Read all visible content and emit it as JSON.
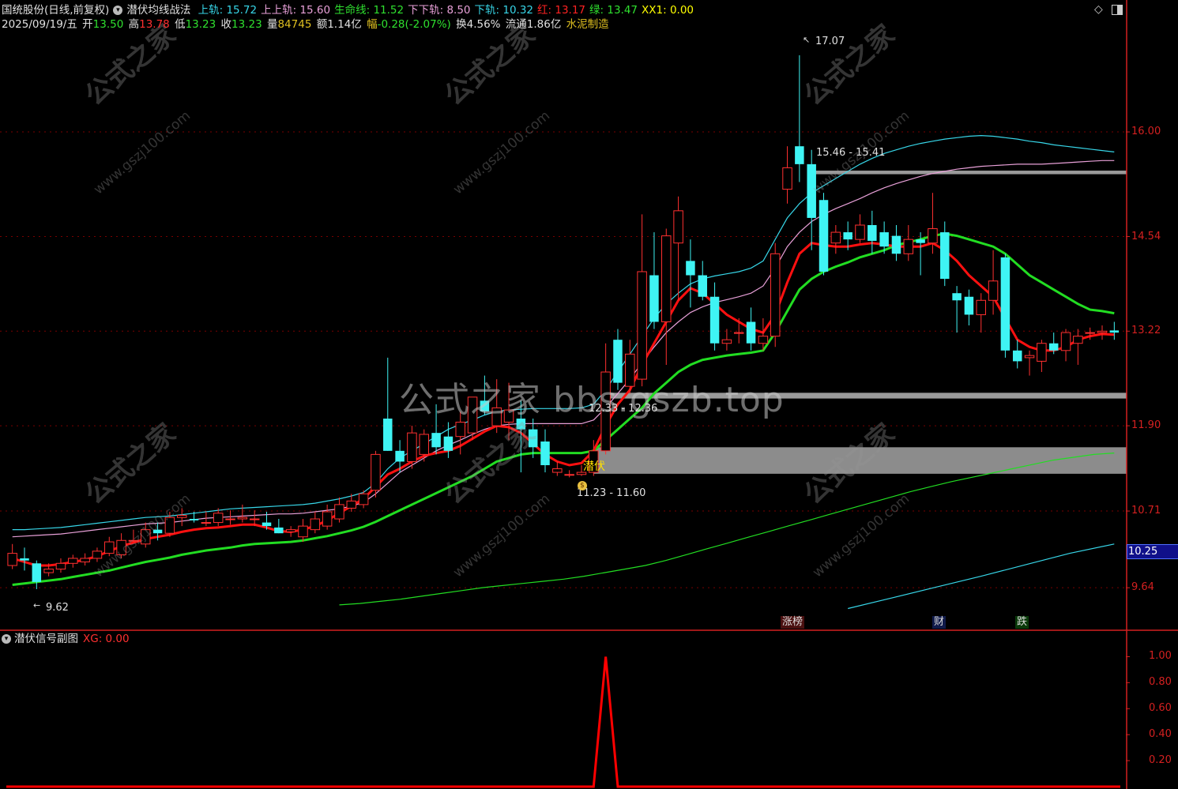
{
  "header": {
    "stock_label": "国统股份(日线,前复权)",
    "indicator_label": "潜伏均线战法",
    "fields": [
      {
        "label": "上轨",
        "value": "15.72",
        "color": "#37d6e8"
      },
      {
        "label": "上上轨",
        "value": "15.60",
        "color": "#e8a0d8"
      },
      {
        "label": "生命线",
        "value": "11.52",
        "color": "#2fe02f"
      },
      {
        "label": "下下轨",
        "value": "8.50",
        "color": "#e8a0d8"
      },
      {
        "label": "下轨",
        "value": "10.32",
        "color": "#37d6e8"
      },
      {
        "label": "红",
        "value": "13.17",
        "color": "#ff2222"
      },
      {
        "label": "绿",
        "value": "13.47",
        "color": "#2fe02f"
      },
      {
        "label": "XX1",
        "value": "0.00",
        "color": "#ffff00"
      }
    ]
  },
  "quote": {
    "date": "2025/09/19/五",
    "open_label": "开",
    "open": "13.50",
    "high_label": "高",
    "high": "13.78",
    "low_label": "低",
    "low": "13.23",
    "close_label": "收",
    "close": "13.23",
    "vol_label": "量",
    "vol": "84745",
    "amt_label": "额",
    "amt": "1.14亿",
    "chg_label": "幅",
    "chg": "-0.28(-2.07%)",
    "turn_label": "换",
    "turn": "4.56%",
    "float_label": "流通",
    "float": "1.86亿",
    "industry": "水泥制造"
  },
  "colors": {
    "up": "#ff3030",
    "down": "#3ff4f4",
    "grid": "#7a0000",
    "axis": "#d42020",
    "red_line": "#ff1010",
    "green_line": "#22dd22"
  },
  "annotations": {
    "high_label": "17.07",
    "low_label": "9.62",
    "zone_top": "15.46 - 15.41",
    "zone_mid": "12.33 - 12.36",
    "zone_low": "11.23 - 11.60",
    "signal": "潜伏",
    "current_price": "10.25"
  },
  "events": [
    {
      "label": "涨榜",
      "color": "#ff9090"
    },
    {
      "label": "财",
      "color": "#9fc8ff"
    },
    {
      "label": "跌",
      "color": "#40ff40"
    }
  ],
  "watermark": {
    "center": "公式之家 bbs.gszb.top",
    "stamp": "公式之家",
    "stamp_url": "www.gszj100.com"
  },
  "sub_panel": {
    "title": "潜伏信号副图",
    "xg_label": "XG: 0.00"
  },
  "chart_data": [
    {
      "type": "candlestick",
      "y_ticks": [
        "16.00",
        "14.54",
        "13.22",
        "11.90",
        "10.71",
        "9.64"
      ],
      "ylim": [
        9.3,
        17.4
      ],
      "grid": true,
      "candles": [
        {
          "o": 9.95,
          "h": 10.25,
          "l": 9.9,
          "c": 10.12
        },
        {
          "o": 10.05,
          "h": 10.2,
          "l": 9.88,
          "c": 10.02
        },
        {
          "o": 9.98,
          "h": 10.02,
          "l": 9.62,
          "c": 9.72
        },
        {
          "o": 9.85,
          "h": 9.98,
          "l": 9.8,
          "c": 9.9
        },
        {
          "o": 9.9,
          "h": 10.05,
          "l": 9.85,
          "c": 9.98
        },
        {
          "o": 9.98,
          "h": 10.1,
          "l": 9.92,
          "c": 10.05
        },
        {
          "o": 10.0,
          "h": 10.12,
          "l": 9.95,
          "c": 10.05
        },
        {
          "o": 10.05,
          "h": 10.2,
          "l": 10.0,
          "c": 10.15
        },
        {
          "o": 10.12,
          "h": 10.35,
          "l": 10.08,
          "c": 10.28
        },
        {
          "o": 10.1,
          "h": 10.4,
          "l": 10.05,
          "c": 10.3
        },
        {
          "o": 10.3,
          "h": 10.45,
          "l": 10.28,
          "c": 10.3
        },
        {
          "o": 10.25,
          "h": 10.55,
          "l": 10.2,
          "c": 10.45
        },
        {
          "o": 10.45,
          "h": 10.55,
          "l": 10.3,
          "c": 10.4
        },
        {
          "o": 10.4,
          "h": 10.7,
          "l": 10.35,
          "c": 10.62
        },
        {
          "o": 10.62,
          "h": 10.75,
          "l": 10.5,
          "c": 10.65
        },
        {
          "o": 10.6,
          "h": 10.7,
          "l": 10.55,
          "c": 10.58
        },
        {
          "o": 10.55,
          "h": 10.7,
          "l": 10.5,
          "c": 10.55
        },
        {
          "o": 10.55,
          "h": 10.75,
          "l": 10.5,
          "c": 10.68
        },
        {
          "o": 10.6,
          "h": 10.72,
          "l": 10.52,
          "c": 10.6
        },
        {
          "o": 10.6,
          "h": 10.8,
          "l": 10.55,
          "c": 10.62
        },
        {
          "o": 10.6,
          "h": 10.72,
          "l": 10.5,
          "c": 10.6
        },
        {
          "o": 10.55,
          "h": 10.7,
          "l": 10.45,
          "c": 10.5
        },
        {
          "o": 10.48,
          "h": 10.6,
          "l": 10.4,
          "c": 10.4
        },
        {
          "o": 10.42,
          "h": 10.5,
          "l": 10.35,
          "c": 10.45
        },
        {
          "o": 10.35,
          "h": 10.6,
          "l": 10.28,
          "c": 10.5
        },
        {
          "o": 10.45,
          "h": 10.7,
          "l": 10.4,
          "c": 10.6
        },
        {
          "o": 10.5,
          "h": 10.8,
          "l": 10.45,
          "c": 10.7
        },
        {
          "o": 10.6,
          "h": 10.9,
          "l": 10.55,
          "c": 10.8
        },
        {
          "o": 10.75,
          "h": 10.95,
          "l": 10.7,
          "c": 10.85
        },
        {
          "o": 10.8,
          "h": 11.0,
          "l": 10.75,
          "c": 10.95
        },
        {
          "o": 11.0,
          "h": 11.55,
          "l": 10.9,
          "c": 11.5
        },
        {
          "o": 12.0,
          "h": 12.85,
          "l": 11.55,
          "c": 11.55
        },
        {
          "o": 11.55,
          "h": 11.7,
          "l": 11.25,
          "c": 11.4
        },
        {
          "o": 11.4,
          "h": 11.9,
          "l": 11.3,
          "c": 11.8
        },
        {
          "o": 11.5,
          "h": 11.85,
          "l": 11.4,
          "c": 11.78
        },
        {
          "o": 11.8,
          "h": 12.2,
          "l": 11.5,
          "c": 11.6
        },
        {
          "o": 11.75,
          "h": 11.95,
          "l": 11.45,
          "c": 11.55
        },
        {
          "o": 11.75,
          "h": 12.1,
          "l": 11.5,
          "c": 11.95
        },
        {
          "o": 11.8,
          "h": 12.3,
          "l": 11.7,
          "c": 12.3
        },
        {
          "o": 12.25,
          "h": 12.6,
          "l": 12.05,
          "c": 12.1
        },
        {
          "o": 11.9,
          "h": 12.55,
          "l": 11.8,
          "c": 12.15
        },
        {
          "o": 11.95,
          "h": 12.5,
          "l": 11.7,
          "c": 12.12
        },
        {
          "o": 12.0,
          "h": 12.25,
          "l": 11.25,
          "c": 11.85
        },
        {
          "o": 11.85,
          "h": 12.0,
          "l": 11.45,
          "c": 11.6
        },
        {
          "o": 11.68,
          "h": 11.85,
          "l": 11.25,
          "c": 11.35
        },
        {
          "o": 11.25,
          "h": 11.4,
          "l": 11.2,
          "c": 11.3
        },
        {
          "o": 11.22,
          "h": 11.28,
          "l": 11.18,
          "c": 11.22
        },
        {
          "o": 11.22,
          "h": 11.35,
          "l": 11.2,
          "c": 11.25
        },
        {
          "o": 11.25,
          "h": 11.7,
          "l": 11.2,
          "c": 11.55
        },
        {
          "o": 11.55,
          "h": 13.05,
          "l": 11.5,
          "c": 12.65
        },
        {
          "o": 13.1,
          "h": 13.25,
          "l": 12.4,
          "c": 12.5
        },
        {
          "o": 12.45,
          "h": 13.1,
          "l": 12.35,
          "c": 12.9
        },
        {
          "o": 12.55,
          "h": 14.85,
          "l": 12.45,
          "c": 14.05
        },
        {
          "o": 14.0,
          "h": 14.6,
          "l": 13.25,
          "c": 13.35
        },
        {
          "o": 13.35,
          "h": 14.65,
          "l": 12.75,
          "c": 14.55
        },
        {
          "o": 14.45,
          "h": 15.1,
          "l": 13.65,
          "c": 14.9
        },
        {
          "o": 14.2,
          "h": 14.5,
          "l": 13.55,
          "c": 14.0
        },
        {
          "o": 14.0,
          "h": 14.2,
          "l": 13.65,
          "c": 13.7
        },
        {
          "o": 13.7,
          "h": 13.9,
          "l": 12.95,
          "c": 13.05
        },
        {
          "o": 13.05,
          "h": 13.25,
          "l": 12.95,
          "c": 13.1
        },
        {
          "o": 13.2,
          "h": 13.4,
          "l": 13.05,
          "c": 13.2
        },
        {
          "o": 13.35,
          "h": 13.55,
          "l": 12.95,
          "c": 13.05
        },
        {
          "o": 13.05,
          "h": 13.4,
          "l": 12.95,
          "c": 13.15
        },
        {
          "o": 13.15,
          "h": 14.45,
          "l": 13.0,
          "c": 14.3
        },
        {
          "o": 15.2,
          "h": 15.8,
          "l": 15.0,
          "c": 15.5
        },
        {
          "o": 15.8,
          "h": 17.07,
          "l": 15.3,
          "c": 15.55
        },
        {
          "o": 15.55,
          "h": 15.75,
          "l": 14.35,
          "c": 14.8
        },
        {
          "o": 15.05,
          "h": 15.15,
          "l": 14.0,
          "c": 14.05
        },
        {
          "o": 14.45,
          "h": 14.7,
          "l": 14.3,
          "c": 14.6
        },
        {
          "o": 14.6,
          "h": 14.75,
          "l": 14.35,
          "c": 14.5
        },
        {
          "o": 14.5,
          "h": 14.85,
          "l": 14.45,
          "c": 14.7
        },
        {
          "o": 14.7,
          "h": 14.9,
          "l": 14.3,
          "c": 14.48
        },
        {
          "o": 14.6,
          "h": 14.75,
          "l": 14.3,
          "c": 14.4
        },
        {
          "o": 14.55,
          "h": 14.7,
          "l": 14.2,
          "c": 14.3
        },
        {
          "o": 14.3,
          "h": 14.7,
          "l": 14.2,
          "c": 14.5
        },
        {
          "o": 14.5,
          "h": 14.6,
          "l": 14.0,
          "c": 14.45
        },
        {
          "o": 14.45,
          "h": 15.15,
          "l": 14.3,
          "c": 14.65
        },
        {
          "o": 14.6,
          "h": 14.75,
          "l": 13.85,
          "c": 13.95
        },
        {
          "o": 13.75,
          "h": 13.85,
          "l": 13.2,
          "c": 13.65
        },
        {
          "o": 13.7,
          "h": 13.8,
          "l": 13.3,
          "c": 13.45
        },
        {
          "o": 13.45,
          "h": 13.75,
          "l": 13.2,
          "c": 13.65
        },
        {
          "o": 13.65,
          "h": 14.35,
          "l": 13.45,
          "c": 13.92
        },
        {
          "o": 14.25,
          "h": 14.3,
          "l": 12.85,
          "c": 12.95
        },
        {
          "o": 12.95,
          "h": 13.1,
          "l": 12.7,
          "c": 12.8
        },
        {
          "o": 12.85,
          "h": 12.95,
          "l": 12.6,
          "c": 12.88
        },
        {
          "o": 12.8,
          "h": 13.1,
          "l": 12.65,
          "c": 13.05
        },
        {
          "o": 13.05,
          "h": 13.2,
          "l": 12.9,
          "c": 12.95
        },
        {
          "o": 12.95,
          "h": 13.25,
          "l": 12.8,
          "c": 13.2
        },
        {
          "o": 13.05,
          "h": 13.25,
          "l": 12.75,
          "c": 13.15
        },
        {
          "o": 13.2,
          "h": 13.27,
          "l": 13.1,
          "c": 13.2
        },
        {
          "o": 13.2,
          "h": 13.3,
          "l": 13.1,
          "c": 13.22
        },
        {
          "o": 13.23,
          "h": 13.35,
          "l": 13.1,
          "c": 13.2
        }
      ],
      "lines": {
        "red": [
          10.05,
          10.0,
          9.95,
          9.95,
          9.97,
          10.0,
          10.03,
          10.08,
          10.15,
          10.22,
          10.27,
          10.32,
          10.35,
          10.38,
          10.42,
          10.45,
          10.47,
          10.48,
          10.5,
          10.52,
          10.52,
          10.48,
          10.43,
          10.42,
          10.45,
          10.5,
          10.58,
          10.68,
          10.78,
          10.88,
          11.05,
          11.22,
          11.3,
          11.4,
          11.48,
          11.52,
          11.55,
          11.62,
          11.72,
          11.82,
          11.9,
          11.88,
          11.8,
          11.65,
          11.5,
          11.4,
          11.35,
          11.38,
          11.55,
          11.9,
          12.2,
          12.4,
          12.75,
          13.05,
          13.35,
          13.65,
          13.82,
          13.75,
          13.6,
          13.45,
          13.35,
          13.25,
          13.2,
          13.45,
          13.9,
          14.3,
          14.45,
          14.42,
          14.4,
          14.4,
          14.43,
          14.45,
          14.43,
          14.4,
          14.4,
          14.4,
          14.45,
          14.35,
          14.2,
          14.0,
          13.85,
          13.7,
          13.4,
          13.1,
          13.0,
          12.95,
          12.95,
          13.0,
          13.1,
          13.15,
          13.18,
          13.17
        ],
        "green": [
          9.68,
          9.7,
          9.72,
          9.74,
          9.76,
          9.79,
          9.82,
          9.85,
          9.88,
          9.92,
          9.96,
          10.0,
          10.03,
          10.06,
          10.1,
          10.13,
          10.16,
          10.18,
          10.2,
          10.23,
          10.25,
          10.26,
          10.27,
          10.28,
          10.3,
          10.33,
          10.36,
          10.4,
          10.44,
          10.49,
          10.56,
          10.64,
          10.72,
          10.8,
          10.88,
          10.96,
          11.04,
          11.12,
          11.2,
          11.3,
          11.4,
          11.45,
          11.5,
          11.52,
          11.52,
          11.52,
          11.52,
          11.52,
          11.55,
          11.7,
          11.85,
          12.0,
          12.15,
          12.35,
          12.5,
          12.65,
          12.75,
          12.82,
          12.85,
          12.88,
          12.9,
          12.92,
          12.95,
          13.2,
          13.5,
          13.8,
          13.95,
          14.05,
          14.12,
          14.18,
          14.25,
          14.3,
          14.35,
          14.42,
          14.46,
          14.5,
          14.55,
          14.58,
          14.55,
          14.5,
          14.45,
          14.4,
          14.3,
          14.15,
          14.0,
          13.9,
          13.8,
          13.7,
          13.6,
          13.52,
          13.5,
          13.47
        ],
        "cyan_upper": [
          10.45,
          10.45,
          10.46,
          10.47,
          10.48,
          10.5,
          10.52,
          10.54,
          10.56,
          10.58,
          10.6,
          10.62,
          10.63,
          10.64,
          10.66,
          10.68,
          10.7,
          10.72,
          10.74,
          10.75,
          10.76,
          10.77,
          10.78,
          10.79,
          10.8,
          10.82,
          10.85,
          10.88,
          10.92,
          10.97,
          11.1,
          11.3,
          11.45,
          11.55,
          11.65,
          11.75,
          11.85,
          11.92,
          11.98,
          12.05,
          12.1,
          12.12,
          12.13,
          12.14,
          12.14,
          12.14,
          12.14,
          12.15,
          12.2,
          12.4,
          12.65,
          12.9,
          13.15,
          13.4,
          13.6,
          13.75,
          13.88,
          13.95,
          13.99,
          14.02,
          14.05,
          14.1,
          14.2,
          14.5,
          14.8,
          15.0,
          15.15,
          15.25,
          15.35,
          15.45,
          15.55,
          15.63,
          15.7,
          15.75,
          15.8,
          15.84,
          15.87,
          15.9,
          15.92,
          15.94,
          15.95,
          15.94,
          15.92,
          15.9,
          15.87,
          15.85,
          15.82,
          15.8,
          15.78,
          15.76,
          15.74,
          15.72
        ],
        "pink_upper": [
          10.35,
          10.36,
          10.37,
          10.38,
          10.39,
          10.41,
          10.43,
          10.45,
          10.47,
          10.49,
          10.51,
          10.53,
          10.54,
          10.55,
          10.57,
          10.59,
          10.61,
          10.62,
          10.63,
          10.64,
          10.65,
          10.66,
          10.67,
          10.67,
          10.68,
          10.7,
          10.72,
          10.74,
          10.78,
          10.83,
          10.95,
          11.1,
          11.25,
          11.35,
          11.45,
          11.55,
          11.63,
          11.7,
          11.78,
          11.85,
          11.9,
          11.92,
          11.93,
          11.93,
          11.93,
          11.93,
          11.93,
          11.93,
          11.98,
          12.15,
          12.35,
          12.55,
          12.78,
          13.0,
          13.2,
          13.35,
          13.48,
          13.56,
          13.62,
          13.66,
          13.7,
          13.75,
          13.85,
          14.1,
          14.4,
          14.6,
          14.75,
          14.85,
          14.93,
          15.0,
          15.07,
          15.15,
          15.22,
          15.28,
          15.33,
          15.38,
          15.42,
          15.45,
          15.48,
          15.5,
          15.52,
          15.53,
          15.54,
          15.55,
          15.55,
          15.55,
          15.56,
          15.57,
          15.58,
          15.59,
          15.6,
          15.6
        ]
      },
      "long_green_line": [
        9.4,
        9.42,
        9.45,
        9.48,
        9.52,
        9.56,
        9.6,
        9.64,
        9.67,
        9.7,
        9.73,
        9.76,
        9.8,
        9.85,
        9.9,
        9.95,
        10.02,
        10.1,
        10.18,
        10.26,
        10.34,
        10.42,
        10.5,
        10.58,
        10.66,
        10.74,
        10.82,
        10.9,
        10.98,
        11.05,
        11.12,
        11.18,
        11.24,
        11.3,
        11.36,
        11.42,
        11.46,
        11.5,
        11.52
      ],
      "blue_line": [
        9.35,
        9.5,
        9.65,
        9.8,
        9.96,
        10.12,
        10.25
      ]
    },
    {
      "type": "line",
      "title": "潜伏信号副图",
      "y_ticks": [
        "1.00",
        "0.80",
        "0.60",
        "0.40",
        "0.20"
      ],
      "ylim": [
        0,
        1.1
      ],
      "signal_index": 49,
      "values_note": "all zeros except one spike to 1.00"
    }
  ]
}
